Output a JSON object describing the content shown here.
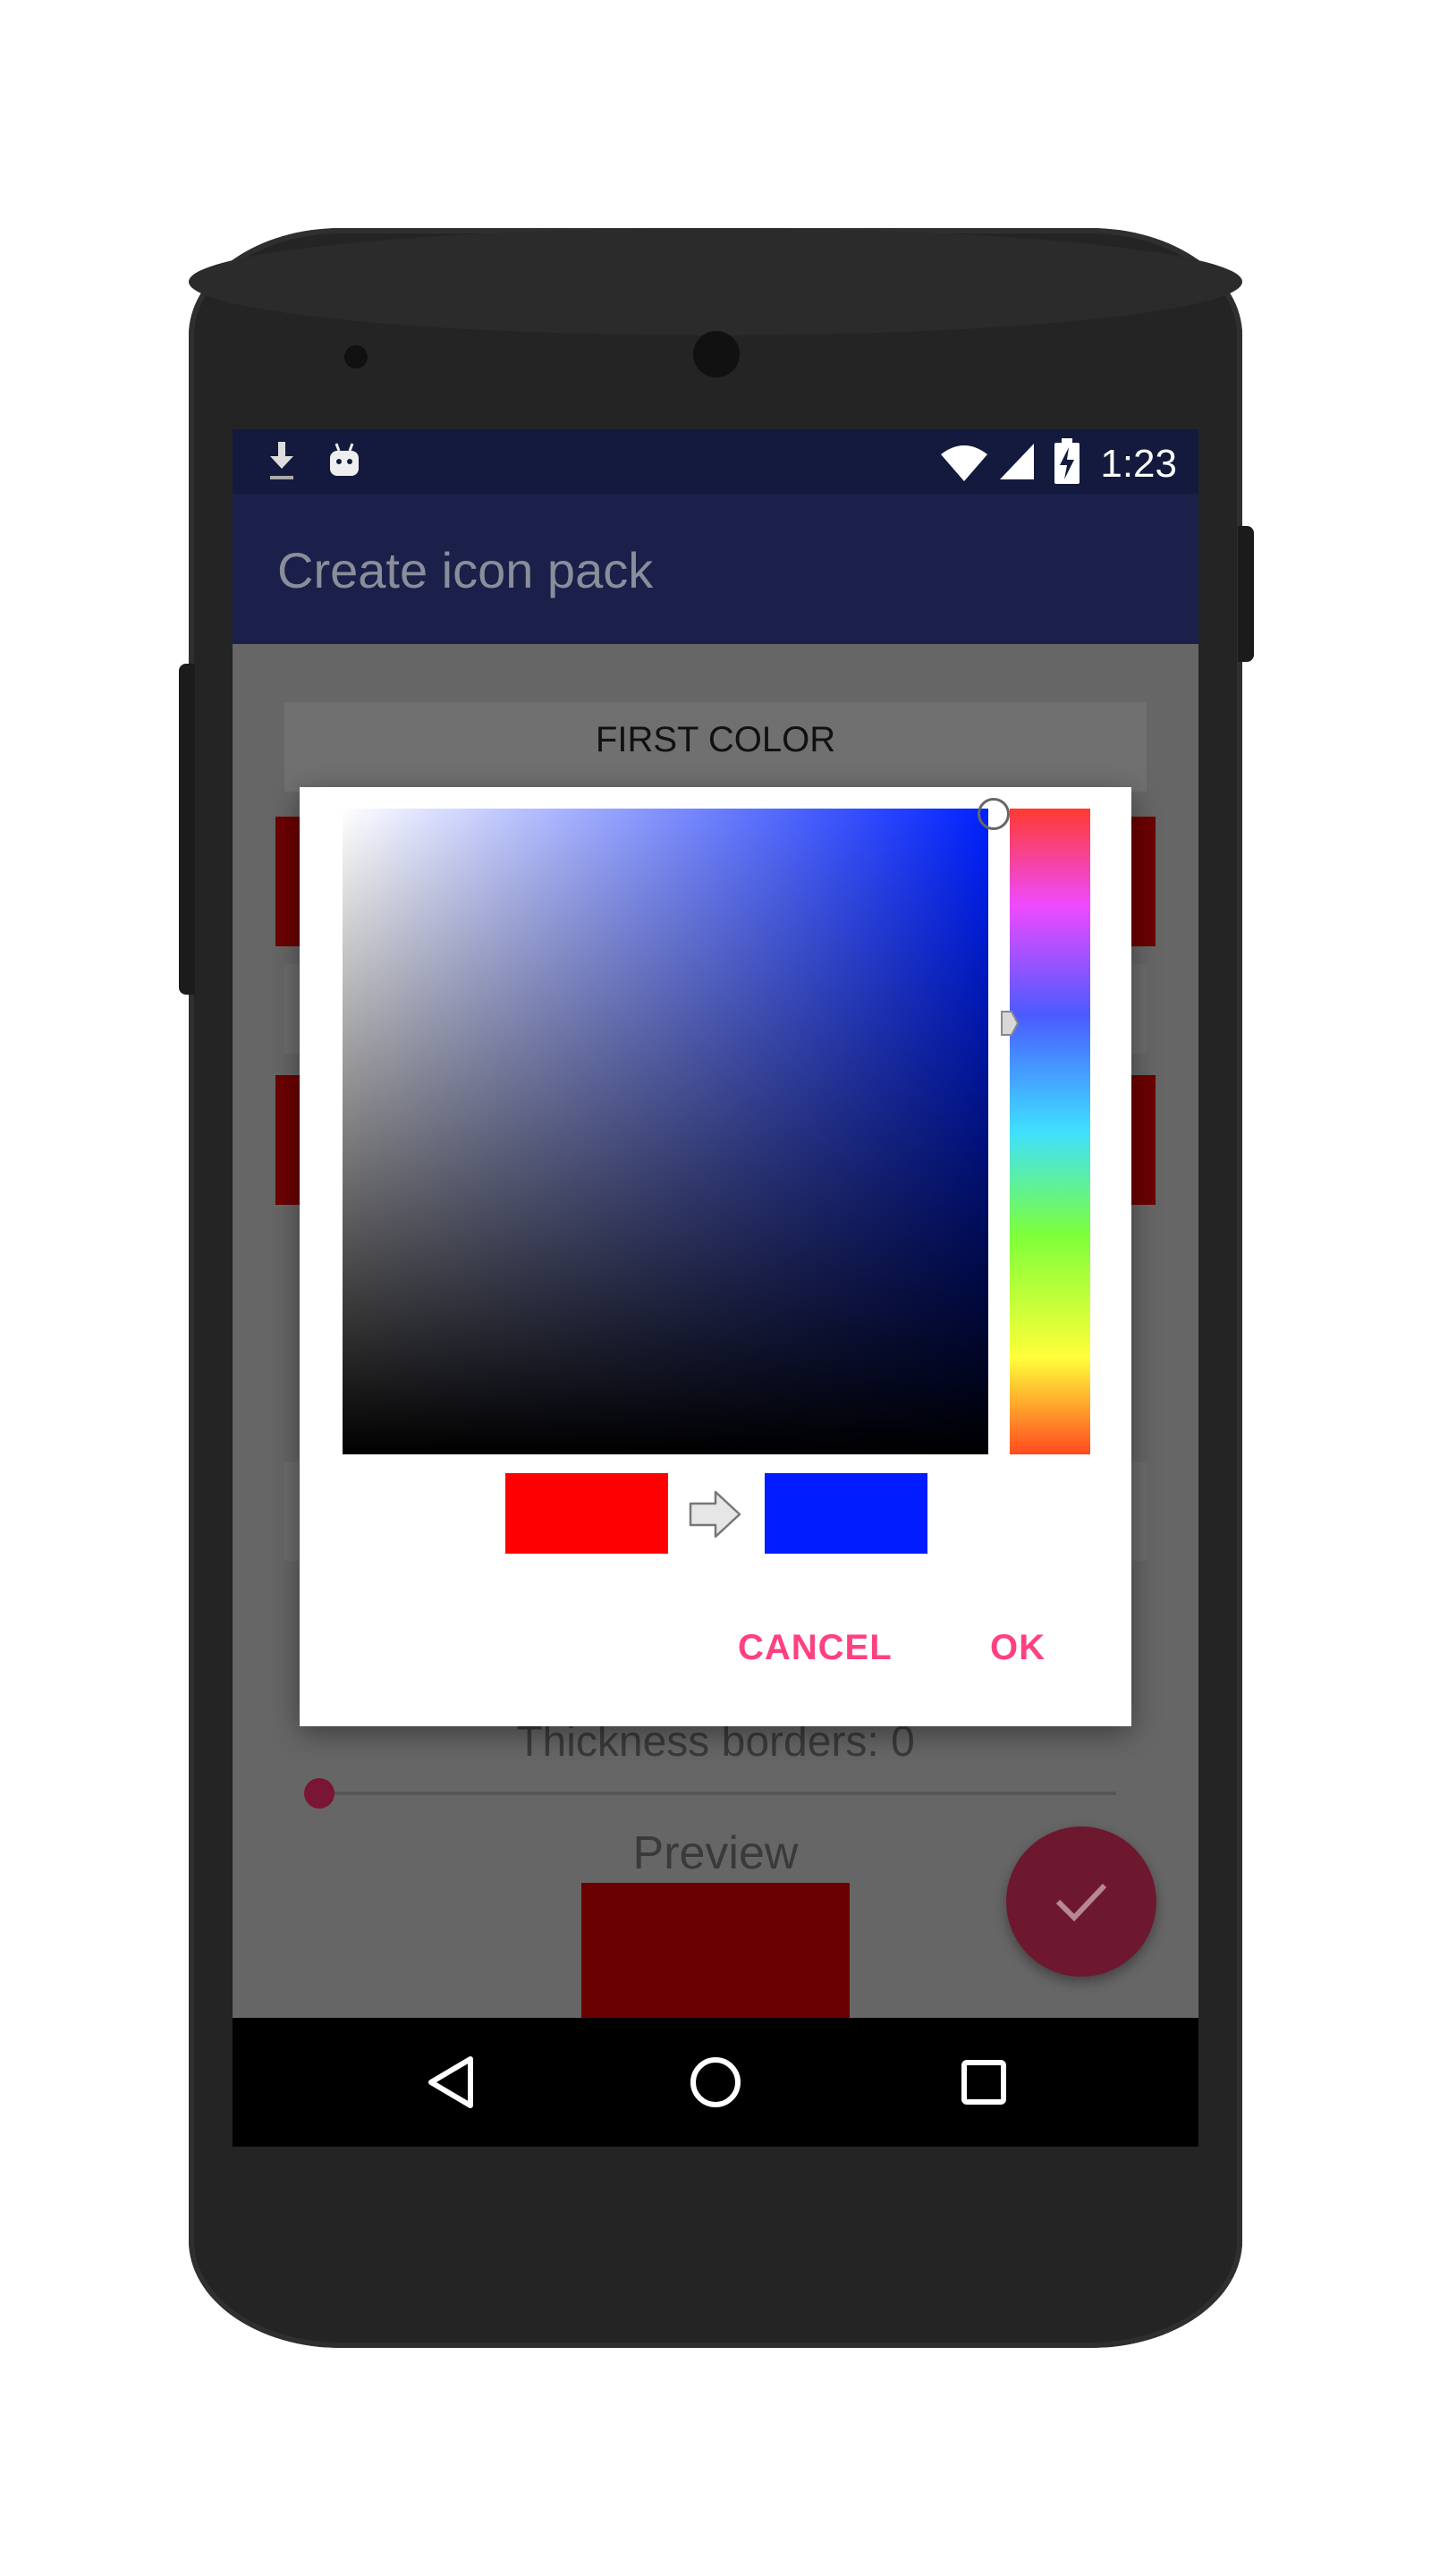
{
  "status_bar": {
    "time": "1:23",
    "left_icons": [
      "download-icon",
      "android-debug-icon"
    ],
    "right_icons": [
      "wifi-icon",
      "signal-icon",
      "battery-charging-icon"
    ]
  },
  "app_bar": {
    "title": "Create icon pack"
  },
  "form": {
    "first_color_label": "FIRST COLOR",
    "thickness_label": "Thickness borders: 0",
    "thickness_value": 0,
    "preview_label": "Preview"
  },
  "fab": {
    "icon": "check-icon",
    "color": "#6e1830"
  },
  "dialog": {
    "old_color": "#ff0000",
    "new_color": "#001cff",
    "hue_color": "#0021ff",
    "cancel_label": "CANCEL",
    "ok_label": "OK"
  },
  "navigation_bar": {
    "icons": [
      "back-icon",
      "home-icon",
      "recents-icon"
    ]
  },
  "colors": {
    "accent": "#ff4081",
    "status_bar": "#131a3d",
    "app_bar": "#1a2049",
    "dark_red": "#6b0000"
  }
}
